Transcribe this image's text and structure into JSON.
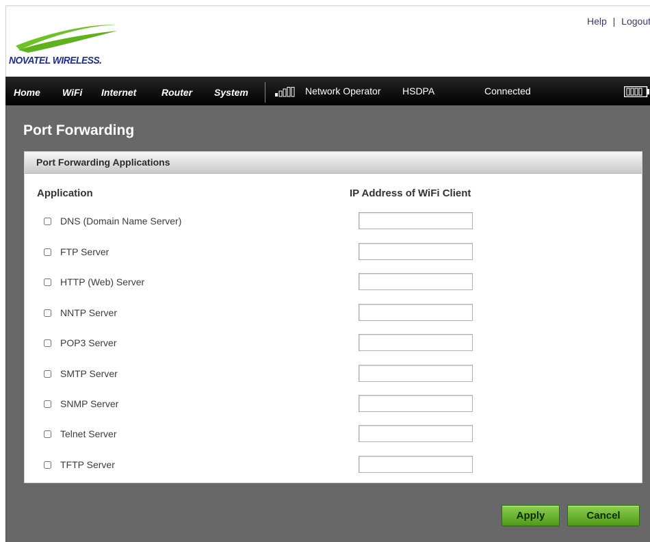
{
  "brand": {
    "name": "NOVATEL WIRELESS."
  },
  "top_links": {
    "help": "Help",
    "separator": "|",
    "logout": "Logout"
  },
  "nav": {
    "items": [
      "Home",
      "WiFi",
      "Internet",
      "Router",
      "System"
    ]
  },
  "status": {
    "operator": "Network Operator",
    "network_type": "HSDPA",
    "connection": "Connected"
  },
  "page": {
    "title": "Port Forwarding"
  },
  "panel": {
    "title": "Port Forwarding Applications",
    "col_application": "Application",
    "col_ip": "IP Address of WiFi Client",
    "applications": [
      {
        "label": "DNS (Domain Name Server)",
        "checked": false,
        "ip": ""
      },
      {
        "label": "FTP Server",
        "checked": false,
        "ip": ""
      },
      {
        "label": "HTTP (Web) Server",
        "checked": false,
        "ip": ""
      },
      {
        "label": "NNTP Server",
        "checked": false,
        "ip": ""
      },
      {
        "label": "POP3 Server",
        "checked": false,
        "ip": ""
      },
      {
        "label": "SMTP Server",
        "checked": false,
        "ip": ""
      },
      {
        "label": "SNMP Server",
        "checked": false,
        "ip": ""
      },
      {
        "label": "Telnet Server",
        "checked": false,
        "ip": ""
      },
      {
        "label": "TFTP Server",
        "checked": false,
        "ip": ""
      }
    ]
  },
  "buttons": {
    "apply": "Apply",
    "cancel": "Cancel"
  },
  "colors": {
    "brand_blue": "#1b2f8f",
    "swoosh_green": "#6cc226",
    "navbar": "#000000",
    "content_bg": "#686868",
    "button_green": "#6cb732"
  }
}
